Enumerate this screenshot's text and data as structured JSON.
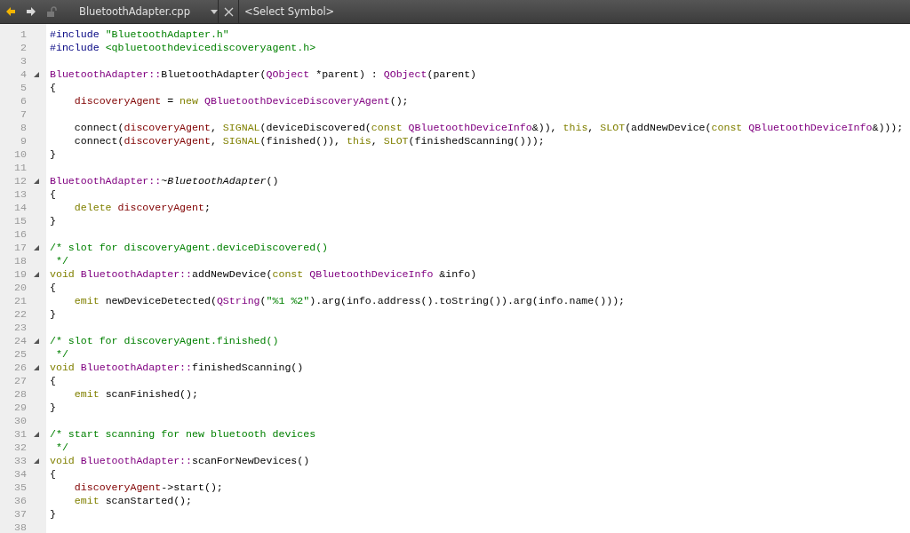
{
  "toolbar": {
    "file_combo": "BluetoothAdapter.cpp",
    "symbol_combo": "<Select Symbol>"
  },
  "editor": {
    "lines": [
      {
        "number": "1",
        "fold": false,
        "indented": false,
        "tokens": [
          {
            "kind": "preproc",
            "text": "#include "
          },
          {
            "kind": "string",
            "text": "\"BluetoothAdapter.h\""
          }
        ]
      },
      {
        "number": "2",
        "fold": false,
        "indented": false,
        "tokens": [
          {
            "kind": "preproc",
            "text": "#include "
          },
          {
            "kind": "string",
            "text": "<qbluetoothdevicediscoveryagent.h>"
          }
        ]
      },
      {
        "number": "3",
        "fold": false
      },
      {
        "number": "4",
        "fold": true,
        "indented": false,
        "tokens": [
          {
            "kind": "type",
            "text": "BluetoothAdapter::"
          },
          {
            "kind": "plain",
            "text": "BluetoothAdapter("
          },
          {
            "kind": "type",
            "text": "QObject"
          },
          {
            "kind": "plain",
            "text": " *parent) : "
          },
          {
            "kind": "type",
            "text": "QObject"
          },
          {
            "kind": "plain",
            "text": "(parent)"
          }
        ]
      },
      {
        "number": "5",
        "fold": false,
        "indented": false,
        "tokens": [
          {
            "kind": "plain",
            "text": "{"
          }
        ]
      },
      {
        "number": "6",
        "fold": false,
        "indented": true,
        "tokens": [
          {
            "kind": "member",
            "text": "discoveryAgent"
          },
          {
            "kind": "plain",
            "text": " = "
          },
          {
            "kind": "keyword",
            "text": "new "
          },
          {
            "kind": "type",
            "text": "QBluetoothDeviceDiscoveryAgent"
          },
          {
            "kind": "plain",
            "text": "();"
          }
        ]
      },
      {
        "number": "7",
        "fold": false
      },
      {
        "number": "8",
        "fold": false,
        "indented": true,
        "tokens": [
          {
            "kind": "plain",
            "text": "connect("
          },
          {
            "kind": "member",
            "text": "discoveryAgent"
          },
          {
            "kind": "plain",
            "text": ", "
          },
          {
            "kind": "keyword",
            "text": "SIGNAL"
          },
          {
            "kind": "plain",
            "text": "(deviceDiscovered("
          },
          {
            "kind": "keyword",
            "text": "const "
          },
          {
            "kind": "type",
            "text": "QBluetoothDeviceInfo"
          },
          {
            "kind": "plain",
            "text": "&)), "
          },
          {
            "kind": "keyword",
            "text": "this"
          },
          {
            "kind": "plain",
            "text": ", "
          },
          {
            "kind": "keyword",
            "text": "SLOT"
          },
          {
            "kind": "plain",
            "text": "(addNewDevice("
          },
          {
            "kind": "keyword",
            "text": "const "
          },
          {
            "kind": "type",
            "text": "QBluetoothDeviceInfo"
          },
          {
            "kind": "plain",
            "text": "&)));"
          }
        ]
      },
      {
        "number": "9",
        "fold": false,
        "indented": true,
        "tokens": [
          {
            "kind": "plain",
            "text": "connect("
          },
          {
            "kind": "member",
            "text": "discoveryAgent"
          },
          {
            "kind": "plain",
            "text": ", "
          },
          {
            "kind": "keyword",
            "text": "SIGNAL"
          },
          {
            "kind": "plain",
            "text": "(finished()), "
          },
          {
            "kind": "keyword",
            "text": "this"
          },
          {
            "kind": "plain",
            "text": ", "
          },
          {
            "kind": "keyword",
            "text": "SLOT"
          },
          {
            "kind": "plain",
            "text": "(finishedScanning()));"
          }
        ]
      },
      {
        "number": "10",
        "fold": false,
        "indented": false,
        "tokens": [
          {
            "kind": "plain",
            "text": "}"
          }
        ]
      },
      {
        "number": "11",
        "fold": false
      },
      {
        "number": "12",
        "fold": true,
        "indented": false,
        "tokens": [
          {
            "kind": "type",
            "text": "BluetoothAdapter::"
          },
          {
            "kind": "plain",
            "text": "~"
          },
          {
            "kind": "italic",
            "text": "BluetoothAdapter"
          },
          {
            "kind": "plain",
            "text": "()"
          }
        ]
      },
      {
        "number": "13",
        "fold": false,
        "indented": false,
        "tokens": [
          {
            "kind": "plain",
            "text": "{"
          }
        ]
      },
      {
        "number": "14",
        "fold": false,
        "indented": true,
        "tokens": [
          {
            "kind": "keyword",
            "text": "delete "
          },
          {
            "kind": "member",
            "text": "discoveryAgent"
          },
          {
            "kind": "plain",
            "text": ";"
          }
        ]
      },
      {
        "number": "15",
        "fold": false,
        "indented": false,
        "tokens": [
          {
            "kind": "plain",
            "text": "}"
          }
        ]
      },
      {
        "number": "16",
        "fold": false
      },
      {
        "number": "17",
        "fold": true,
        "indented": false,
        "tokens": [
          {
            "kind": "comment",
            "text": "/* slot for discoveryAgent.deviceDiscovered()"
          }
        ]
      },
      {
        "number": "18",
        "fold": false,
        "indented": false,
        "tokens": [
          {
            "kind": "comment",
            "text": " */"
          }
        ]
      },
      {
        "number": "19",
        "fold": true,
        "indented": false,
        "tokens": [
          {
            "kind": "keyword",
            "text": "void "
          },
          {
            "kind": "type",
            "text": "BluetoothAdapter::"
          },
          {
            "kind": "plain",
            "text": "addNewDevice("
          },
          {
            "kind": "keyword",
            "text": "const "
          },
          {
            "kind": "type",
            "text": "QBluetoothDeviceInfo"
          },
          {
            "kind": "plain",
            "text": " &info)"
          }
        ]
      },
      {
        "number": "20",
        "fold": false,
        "indented": false,
        "tokens": [
          {
            "kind": "plain",
            "text": "{"
          }
        ]
      },
      {
        "number": "21",
        "fold": false,
        "indented": true,
        "tokens": [
          {
            "kind": "keyword",
            "text": "emit"
          },
          {
            "kind": "plain",
            "text": " newDeviceDetected("
          },
          {
            "kind": "type",
            "text": "QString"
          },
          {
            "kind": "plain",
            "text": "("
          },
          {
            "kind": "string",
            "text": "\"%1 %2\""
          },
          {
            "kind": "plain",
            "text": ").arg(info.address().toString()).arg(info.name()));"
          }
        ]
      },
      {
        "number": "22",
        "fold": false,
        "indented": false,
        "tokens": [
          {
            "kind": "plain",
            "text": "}"
          }
        ]
      },
      {
        "number": "23",
        "fold": false
      },
      {
        "number": "24",
        "fold": true,
        "indented": false,
        "tokens": [
          {
            "kind": "comment",
            "text": "/* slot for discoveryAgent.finished()"
          }
        ]
      },
      {
        "number": "25",
        "fold": false,
        "indented": false,
        "tokens": [
          {
            "kind": "comment",
            "text": " */"
          }
        ]
      },
      {
        "number": "26",
        "fold": true,
        "indented": false,
        "tokens": [
          {
            "kind": "keyword",
            "text": "void "
          },
          {
            "kind": "type",
            "text": "BluetoothAdapter::"
          },
          {
            "kind": "plain",
            "text": "finishedScanning()"
          }
        ]
      },
      {
        "number": "27",
        "fold": false,
        "indented": false,
        "tokens": [
          {
            "kind": "plain",
            "text": "{"
          }
        ]
      },
      {
        "number": "28",
        "fold": false,
        "indented": true,
        "tokens": [
          {
            "kind": "keyword",
            "text": "emit"
          },
          {
            "kind": "plain",
            "text": " scanFinished();"
          }
        ]
      },
      {
        "number": "29",
        "fold": false,
        "indented": false,
        "tokens": [
          {
            "kind": "plain",
            "text": "}"
          }
        ]
      },
      {
        "number": "30",
        "fold": false
      },
      {
        "number": "31",
        "fold": true,
        "indented": false,
        "tokens": [
          {
            "kind": "comment",
            "text": "/* start scanning for new bluetooth devices"
          }
        ]
      },
      {
        "number": "32",
        "fold": false,
        "indented": false,
        "tokens": [
          {
            "kind": "comment",
            "text": " */"
          }
        ]
      },
      {
        "number": "33",
        "fold": true,
        "indented": false,
        "tokens": [
          {
            "kind": "keyword",
            "text": "void "
          },
          {
            "kind": "type",
            "text": "BluetoothAdapter::"
          },
          {
            "kind": "plain",
            "text": "scanForNewDevices()"
          }
        ]
      },
      {
        "number": "34",
        "fold": false,
        "indented": false,
        "tokens": [
          {
            "kind": "plain",
            "text": "{"
          }
        ]
      },
      {
        "number": "35",
        "fold": false,
        "indented": true,
        "tokens": [
          {
            "kind": "member",
            "text": "discoveryAgent"
          },
          {
            "kind": "plain",
            "text": "->start();"
          }
        ]
      },
      {
        "number": "36",
        "fold": false,
        "indented": true,
        "tokens": [
          {
            "kind": "keyword",
            "text": "emit"
          },
          {
            "kind": "plain",
            "text": " scanStarted();"
          }
        ]
      },
      {
        "number": "37",
        "fold": false,
        "indented": false,
        "tokens": [
          {
            "kind": "plain",
            "text": "}"
          }
        ]
      },
      {
        "number": "38",
        "fold": false
      }
    ]
  }
}
